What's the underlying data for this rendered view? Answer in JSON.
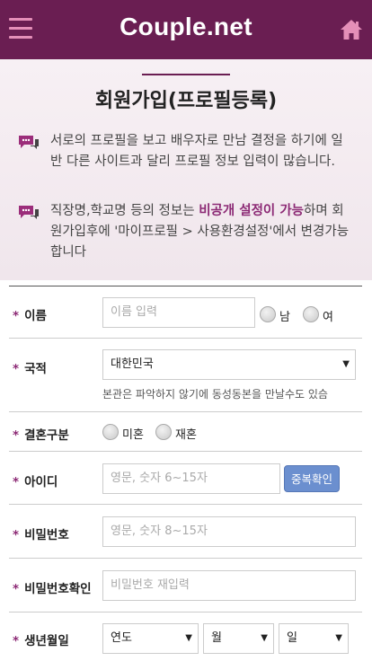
{
  "header": {
    "brand": "Couple.net",
    "colors": {
      "bar": "#6a1e52",
      "accent": "#8c2a75",
      "button": "#6b8fcf"
    },
    "menu_icon": "hamburger-icon",
    "home_icon": "home-icon"
  },
  "intro": {
    "title": "회원가입(프로필등록)",
    "note1": "서로의 프로필을 보고 배우자로 만남 결정을 하기에 일반 다른 사이트과 달리 프로필 정보 입력이 많습니다.",
    "note2_pre": "직장명,학교명 등의 정보는 ",
    "note2_highlight": "비공개 설정이 가능",
    "note2_post": "하며 회원가입후에 '마이프로필 > 사용환경설정'에서 변경가능합니다",
    "note_icon": "speech-bubble-icon"
  },
  "form": {
    "required_mark": "*",
    "name": {
      "label": "이름",
      "placeholder": "이름 입력",
      "male": "남",
      "female": "여"
    },
    "nationality": {
      "label": "국적",
      "selected": "대한민국",
      "hint": "본관은 파악하지 않기에 동성동본을 만날수도 있슴"
    },
    "marital": {
      "label": "결혼구분",
      "option1": "미혼",
      "option2": "재혼"
    },
    "userid": {
      "label": "아이디",
      "placeholder": "영문, 숫자 6~15자",
      "check_button": "중복확인"
    },
    "password": {
      "label": "비밀번호",
      "placeholder": "영문, 숫자 8~15자"
    },
    "password_confirm": {
      "label": "비밀번호확인",
      "placeholder": "비밀번호 재입력"
    },
    "birth": {
      "label": "생년월일",
      "year": "연도",
      "month": "월",
      "day": "일"
    }
  }
}
